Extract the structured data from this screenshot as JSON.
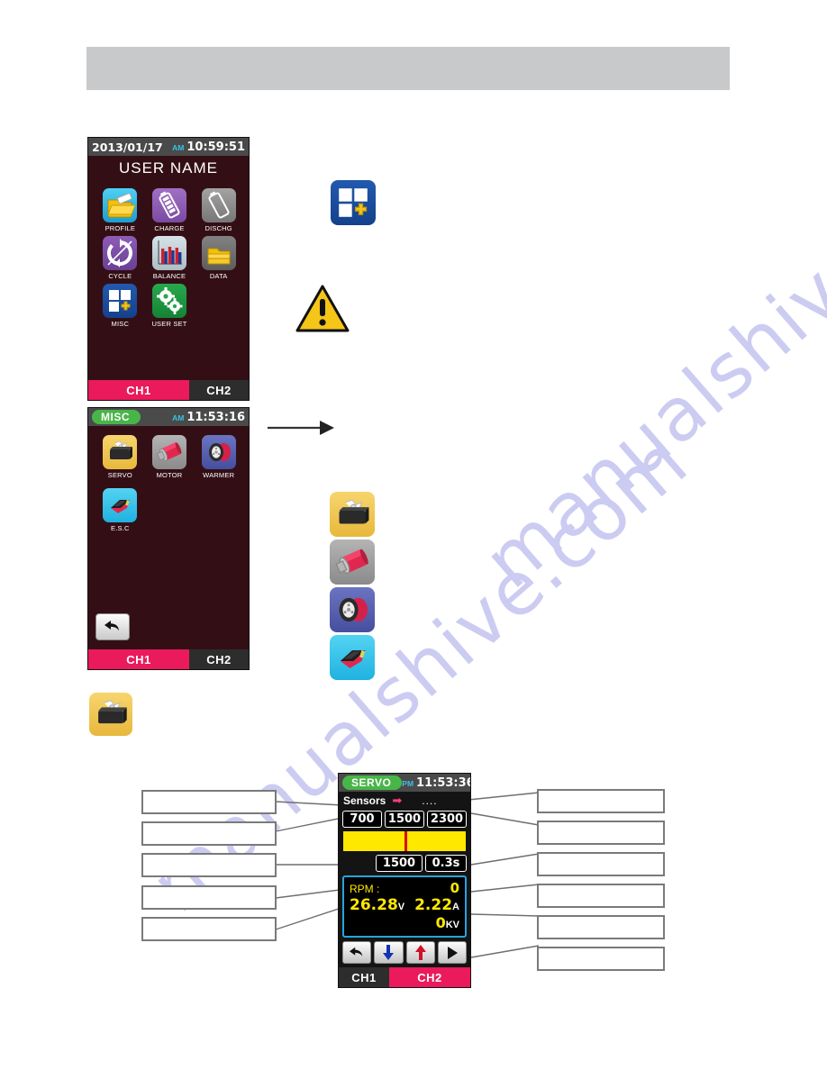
{
  "watermark": {
    "line1": "manualshive.com",
    "line2": "manualshive.com"
  },
  "header": {
    "title": ""
  },
  "home_screen": {
    "name": "home-screen",
    "statusbar": {
      "date": "2013/01/17",
      "ampm": "AM",
      "time": "10:59:51"
    },
    "username": "USER NAME",
    "icons": [
      {
        "label": "PROFILE",
        "icon": "profile-folder-icon",
        "color": "#2fb8e8"
      },
      {
        "label": "CHARGE",
        "icon": "battery-charge-icon",
        "color": "#8f5fb5"
      },
      {
        "label": "DISCHG",
        "icon": "battery-discharge-icon",
        "color": "#8e8e8e"
      },
      {
        "label": "CYCLE",
        "icon": "cycle-arrows-icon",
        "color": "#7b4fa5"
      },
      {
        "label": "BALANCE",
        "icon": "bar-chart-icon",
        "color": "#b9c9cf"
      },
      {
        "label": "DATA",
        "icon": "data-folders-icon",
        "color": "#6f6f6f"
      },
      {
        "label": "MISC",
        "icon": "misc-grid-plus-icon",
        "color": "#1a4fa0"
      },
      {
        "label": "USER SET",
        "icon": "gears-icon",
        "color": "#1f9641"
      }
    ],
    "tabs": [
      {
        "label": "CH1",
        "state": "active"
      },
      {
        "label": "CH2",
        "state": "idle"
      }
    ]
  },
  "misc_screen": {
    "name": "misc-screen",
    "statusbar": {
      "title": "MISC",
      "ampm": "AM",
      "time": "11:53:16"
    },
    "icons": [
      {
        "label": "SERVO",
        "icon": "servo-icon",
        "color": "#f0c95a"
      },
      {
        "label": "MOTOR",
        "icon": "motor-icon",
        "color": "#9a9a9a"
      },
      {
        "label": "WARMER",
        "icon": "warmer-tire-icon",
        "color": "#5b63b0"
      },
      {
        "label": "E.S.C",
        "icon": "esc-icon",
        "color": "#2fc0e8"
      }
    ],
    "back_button": "back-arrow-icon",
    "tabs": [
      {
        "label": "CH1",
        "state": "active"
      },
      {
        "label": "CH2",
        "state": "idle"
      }
    ]
  },
  "servo_screen": {
    "name": "servo-screen",
    "statusbar": {
      "title": "SERVO",
      "ampm": "PM",
      "time": "11:53:36"
    },
    "sensors": {
      "label": "Sensors",
      "arrow": "right-arrow-icon",
      "value": "...."
    },
    "limits": [
      "700",
      "1500",
      "2300"
    ],
    "slider": {
      "position_percent": 50,
      "color": "#ffe800",
      "needle_color": "#e00000"
    },
    "current": {
      "position": "1500",
      "speed": "0.3s"
    },
    "readout": {
      "rpm_label": "RPM :",
      "rpm_value": "0",
      "voltage": "26.28",
      "voltage_unit": "V",
      "current_amp": "2.22",
      "current_unit": "A",
      "kv_value": "0",
      "kv_unit": "KV"
    },
    "buttons": [
      {
        "name": "back-arrow-icon",
        "glyph": "back"
      },
      {
        "name": "down-arrow-icon",
        "glyph": "down"
      },
      {
        "name": "up-arrow-icon",
        "glyph": "up"
      },
      {
        "name": "play-arrow-icon",
        "glyph": "play"
      }
    ],
    "tabs": [
      {
        "label": "CH1",
        "state": "idle"
      },
      {
        "label": "CH2",
        "state": "active"
      }
    ]
  },
  "standalone_icons": [
    {
      "name": "misc-grid-plus-icon",
      "label": ""
    },
    {
      "name": "warning-triangle-icon",
      "label": ""
    },
    {
      "name": "servo-icon",
      "label": ""
    },
    {
      "name": "motor-icon",
      "label": ""
    },
    {
      "name": "warmer-tire-icon",
      "label": ""
    },
    {
      "name": "esc-icon",
      "label": ""
    },
    {
      "name": "servo-icon-small",
      "label": ""
    }
  ],
  "callouts": {
    "left": [
      "",
      "",
      "",
      "",
      ""
    ],
    "right": [
      "",
      "",
      "",
      "",
      "",
      ""
    ]
  },
  "flow_arrow": "right-arrow-connector"
}
